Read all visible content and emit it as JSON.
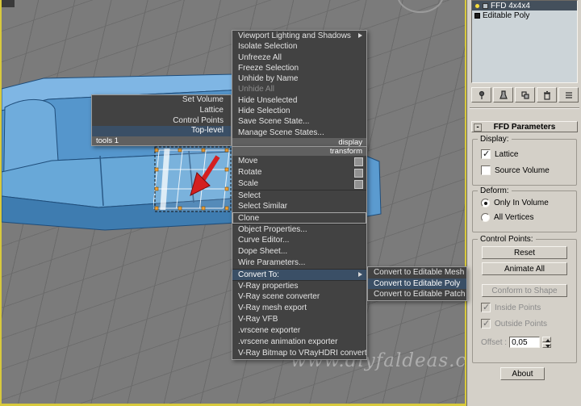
{
  "viewport": {
    "watermark": "www.diyfaldeas.co",
    "active_border_color": "#d8c93c",
    "object": "blue-sofa-model"
  },
  "quad_menu": {
    "tools_quad": {
      "title": "tools 1",
      "items": [
        {
          "label": "Set Volume"
        },
        {
          "label": "Lattice"
        },
        {
          "label": "Control Points"
        },
        {
          "label": "Top-level",
          "highlighted": true
        }
      ]
    },
    "display_quad": {
      "title": "display",
      "items": [
        {
          "label": "Viewport Lighting and Shadows",
          "submenu": true
        },
        {
          "label": "Isolate Selection"
        },
        {
          "label": "Unfreeze All"
        },
        {
          "label": "Freeze Selection"
        },
        {
          "label": "Unhide by Name"
        },
        {
          "label": "Unhide All",
          "disabled": true
        },
        {
          "label": "Hide Unselected"
        },
        {
          "label": "Hide Selection"
        },
        {
          "label": "Save Scene State..."
        },
        {
          "label": "Manage Scene States..."
        }
      ]
    },
    "transform_quad": {
      "title": "transform",
      "items": [
        {
          "label": "Move",
          "icon": true
        },
        {
          "label": "Rotate",
          "icon": true
        },
        {
          "label": "Scale",
          "icon": true
        },
        {
          "label": "Select",
          "sep": true
        },
        {
          "label": "Select Similar"
        },
        {
          "label": "Clone",
          "boxed": true,
          "sep": true
        },
        {
          "label": "Object Properties...",
          "sep": true
        },
        {
          "label": "Curve Editor..."
        },
        {
          "label": "Dope Sheet..."
        },
        {
          "label": "Wire Parameters..."
        },
        {
          "label": "Convert To:",
          "submenu": true,
          "highlighted": true,
          "sep": true
        },
        {
          "label": "V-Ray properties",
          "sep": true
        },
        {
          "label": "V-Ray scene converter"
        },
        {
          "label": "V-Ray mesh export"
        },
        {
          "label": "V-Ray VFB"
        },
        {
          "label": ".vrscene exporter"
        },
        {
          "label": ".vrscene animation exporter"
        },
        {
          "label": "V-Ray Bitmap to VRayHDRI converter"
        }
      ]
    },
    "convert_submenu": {
      "items": [
        {
          "label": "Convert to Editable Mesh"
        },
        {
          "label": "Convert to Editable Poly",
          "highlighted": true
        },
        {
          "label": "Convert to Editable Patch"
        }
      ]
    }
  },
  "command_panel": {
    "modifier_stack": [
      {
        "label": "FFD 4x4x4",
        "selected": true,
        "bulb": true
      },
      {
        "label": "Editable Poly"
      }
    ],
    "stack_toolbar_icons": [
      "pin-stack",
      "show-end-result",
      "make-unique",
      "remove-modifier",
      "configure-modifier-sets"
    ],
    "rollout": {
      "collapse": "-",
      "title": "FFD Parameters"
    },
    "display_group": {
      "title": "Display:",
      "lattice": {
        "label": "Lattice",
        "checked": true
      },
      "source_volume": {
        "label": "Source Volume",
        "checked": false
      }
    },
    "deform_group": {
      "title": "Deform:",
      "only_in_volume": {
        "label": "Only In Volume",
        "selected": true
      },
      "all_vertices": {
        "label": "All Vertices",
        "selected": false
      }
    },
    "control_points_group": {
      "title": "Control Points:",
      "reset": "Reset",
      "animate_all": "Animate All",
      "conform_to_shape": {
        "label": "Conform to Shape",
        "disabled": true
      },
      "inside_points": {
        "label": "Inside Points",
        "checked": true,
        "disabled": true
      },
      "outside_points": {
        "label": "Outside Points",
        "checked": true,
        "disabled": true
      },
      "offset_label": "Offset :",
      "offset_value": "0,05"
    },
    "about": "About"
  }
}
